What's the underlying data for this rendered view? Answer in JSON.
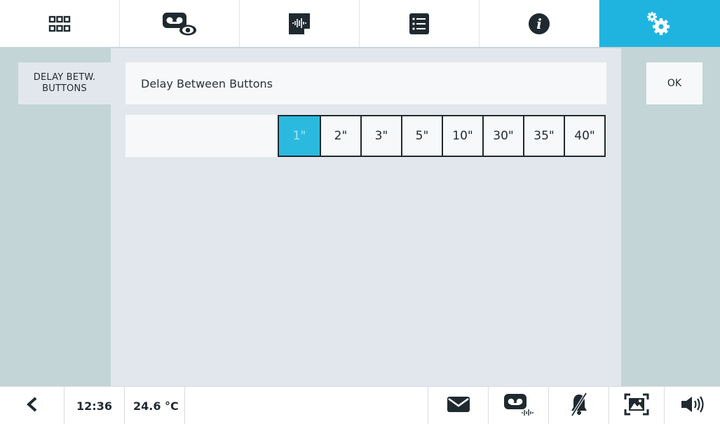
{
  "tabs": [
    {
      "name": "apps-grid-icon",
      "active": false
    },
    {
      "name": "answering-machine-view-icon",
      "active": false
    },
    {
      "name": "audio-message-icon",
      "active": false
    },
    {
      "name": "list-icon",
      "active": false
    },
    {
      "name": "info-icon",
      "active": false
    },
    {
      "name": "settings-gears-icon",
      "active": true
    }
  ],
  "sidebar": {
    "selected_label": "DELAY BETW. BUTTONS"
  },
  "setting": {
    "title": "Delay Between Buttons",
    "options": [
      "1\"",
      "2\"",
      "3\"",
      "5\"",
      "10\"",
      "30\"",
      "35\"",
      "40\""
    ],
    "selected_index": 0
  },
  "actions": {
    "ok_label": "OK"
  },
  "status": {
    "time": "12:36",
    "temperature": "24.6 °C"
  },
  "bottom_icons": [
    "back-arrow-icon",
    "message-icon",
    "answering-machine-icon",
    "bell-mute-icon",
    "picture-icon",
    "speaker-icon"
  ],
  "colors": {
    "accent": "#1fb4e0",
    "selected_option": "#2bbadf",
    "side_panel": "#c3d5d6",
    "content_bg": "#e2e7ee"
  }
}
